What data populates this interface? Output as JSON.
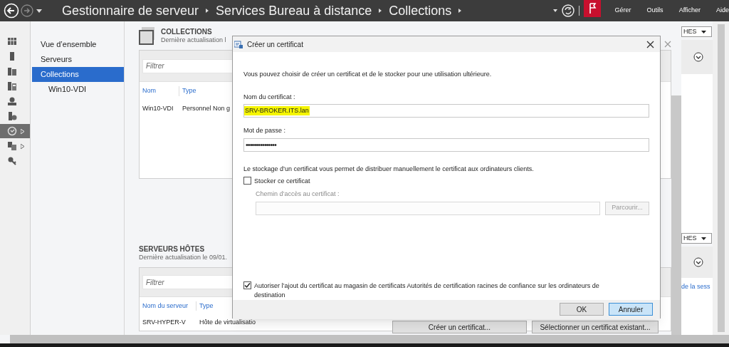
{
  "top_bar": {
    "breadcrumb": [
      "Gestionnaire de serveur",
      "Services Bureau à distance",
      "Collections"
    ],
    "menu": [
      "Gérer",
      "Outils",
      "Afficher",
      "Aide"
    ]
  },
  "icon_nav": [
    {
      "selected": false,
      "expandable": false
    },
    {
      "selected": false,
      "expandable": false
    },
    {
      "selected": false,
      "expandable": false
    },
    {
      "selected": false,
      "expandable": false
    },
    {
      "selected": false,
      "expandable": false
    },
    {
      "selected": false,
      "expandable": false
    },
    {
      "selected": true,
      "expandable": true
    },
    {
      "selected": false,
      "expandable": true
    },
    {
      "selected": false,
      "expandable": false
    }
  ],
  "nav": [
    {
      "label": "Vue d’ensemble",
      "selected": false
    },
    {
      "label": "Serveurs",
      "selected": false
    },
    {
      "label": "Collections",
      "selected": true,
      "children": [
        {
          "label": "Win10-VDI",
          "selected": false
        }
      ]
    }
  ],
  "collections": {
    "title": "COLLECTIONS",
    "subtitle": "Dernière actualisation l",
    "tasks": "HES",
    "filter": {
      "placeholder": "Filtrer"
    },
    "columns": [
      "Nom",
      "Type"
    ],
    "rows": [
      [
        "Win10-VDI",
        "Personnel Non g"
      ]
    ]
  },
  "host_servers": {
    "title": "SERVEURS HÔTES",
    "subtitle": "Dernière actualisation le 09/01.",
    "tasks": "HES",
    "filter": {
      "placeholder": "Filtrer"
    },
    "columns": [
      "Nom du serveur",
      "Type"
    ],
    "column_3": "de la sess",
    "rows": [
      [
        "SRV-HYPER-V",
        "Hôte de virtualisatio"
      ]
    ],
    "buttons": [
      "Créer un certificat...",
      "Sélectionner un certificat existant..."
    ]
  },
  "dialog": {
    "title": "Créer un certificat",
    "intro": "Vous pouvez choisir de créer un certificat et de le stocker pour une utilisation ultérieure.",
    "name_label": "Nom du certificat :",
    "name_value": "SRV-BROKER.ITS.lan",
    "password_label": "Mot de passe :",
    "password_value": "•••••••••••••••",
    "store_text": "Le stockage d’un certificat vous permet de distribuer manuellement le certificat aux ordinateurs clients.",
    "store": {
      "label": "Stocker ce certificat",
      "checked": false
    },
    "path_label": "Chemin d’accès au certificat :",
    "path_disabled": true,
    "browse": "Parcourir...",
    "trust": {
      "label": "Autoriser l’ajout du certificat au magasin de certificats Autorités de certification racines de confiance sur les ordinateurs de destination",
      "checked": true
    },
    "buttons": [
      {
        "label": "OK",
        "default": false
      },
      {
        "label": "Annuler",
        "default": true
      }
    ]
  }
}
